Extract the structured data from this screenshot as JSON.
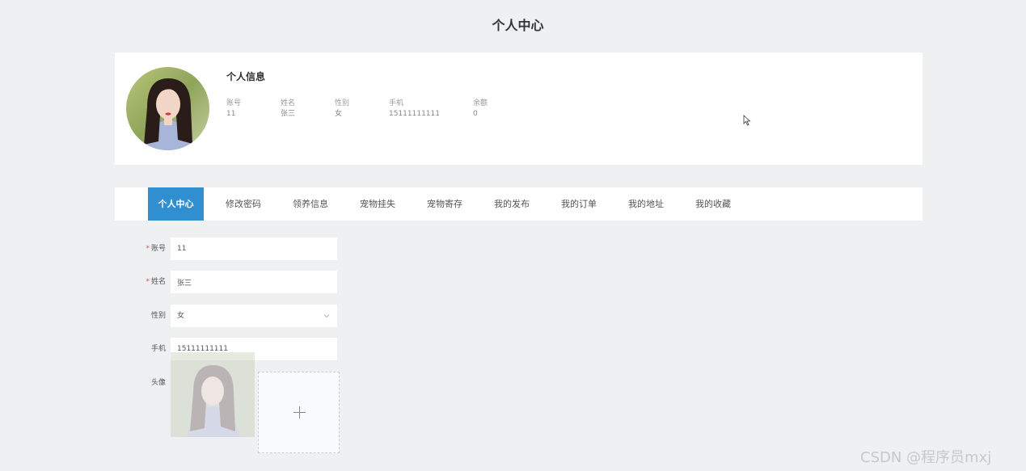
{
  "header": {
    "title": "个人中心"
  },
  "profile": {
    "title": "个人信息",
    "fields": [
      {
        "label": "账号",
        "value": "11"
      },
      {
        "label": "姓名",
        "value": "张三"
      },
      {
        "label": "性别",
        "value": "女"
      },
      {
        "label": "手机",
        "value": "15111111111"
      },
      {
        "label": "余额",
        "value": "0"
      }
    ]
  },
  "tabs": [
    {
      "label": "个人中心",
      "active": true
    },
    {
      "label": "修改密码"
    },
    {
      "label": "领养信息"
    },
    {
      "label": "宠物挂失"
    },
    {
      "label": "宠物寄存"
    },
    {
      "label": "我的发布"
    },
    {
      "label": "我的订单"
    },
    {
      "label": "我的地址"
    },
    {
      "label": "我的收藏"
    }
  ],
  "form": {
    "account": {
      "label": "账号",
      "value": "11",
      "required": "*"
    },
    "name": {
      "label": "姓名",
      "value": "张三",
      "required": "*"
    },
    "gender": {
      "label": "性别",
      "value": "女"
    },
    "phone": {
      "label": "手机",
      "value": "15111111111"
    },
    "avatar": {
      "label": "头像"
    }
  },
  "watermark": "CSDN @程序员mxj",
  "colors": {
    "accent": "#2f8fd0",
    "required": "#e55353",
    "background": "#eff0f2"
  }
}
